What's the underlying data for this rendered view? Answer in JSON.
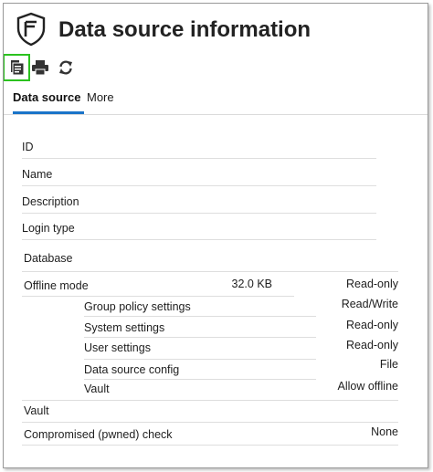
{
  "header": {
    "title": "Data source information"
  },
  "toolbar": {
    "icons": [
      "report-icon",
      "print-icon",
      "refresh-icon"
    ]
  },
  "tabs": [
    {
      "label": "Data source",
      "active": true
    },
    {
      "label": "More",
      "active": false
    }
  ],
  "fields": {
    "id": {
      "label": "ID"
    },
    "name": {
      "label": "Name"
    },
    "description": {
      "label": "Description"
    },
    "login_type": {
      "label": "Login type"
    },
    "database": {
      "label": "Database"
    },
    "offline_mode": {
      "label": "Offline mode",
      "size": "32.0 KB",
      "value": "Read-only"
    },
    "group_policy": {
      "label": "Group policy settings",
      "value": "Read/Write"
    },
    "system_settings": {
      "label": "System settings",
      "value": "Read-only"
    },
    "user_settings": {
      "label": "User settings",
      "value": "Read-only"
    },
    "ds_config": {
      "label": "Data source config",
      "value": "File"
    },
    "vault_sub": {
      "label": "Vault",
      "value": "Allow offline"
    },
    "vault": {
      "label": "Vault"
    },
    "pwned": {
      "label": "Compromised (pwned) check",
      "value": "None"
    }
  },
  "colors": {
    "accent": "#1a74c8",
    "highlight": "#2bc21f"
  }
}
